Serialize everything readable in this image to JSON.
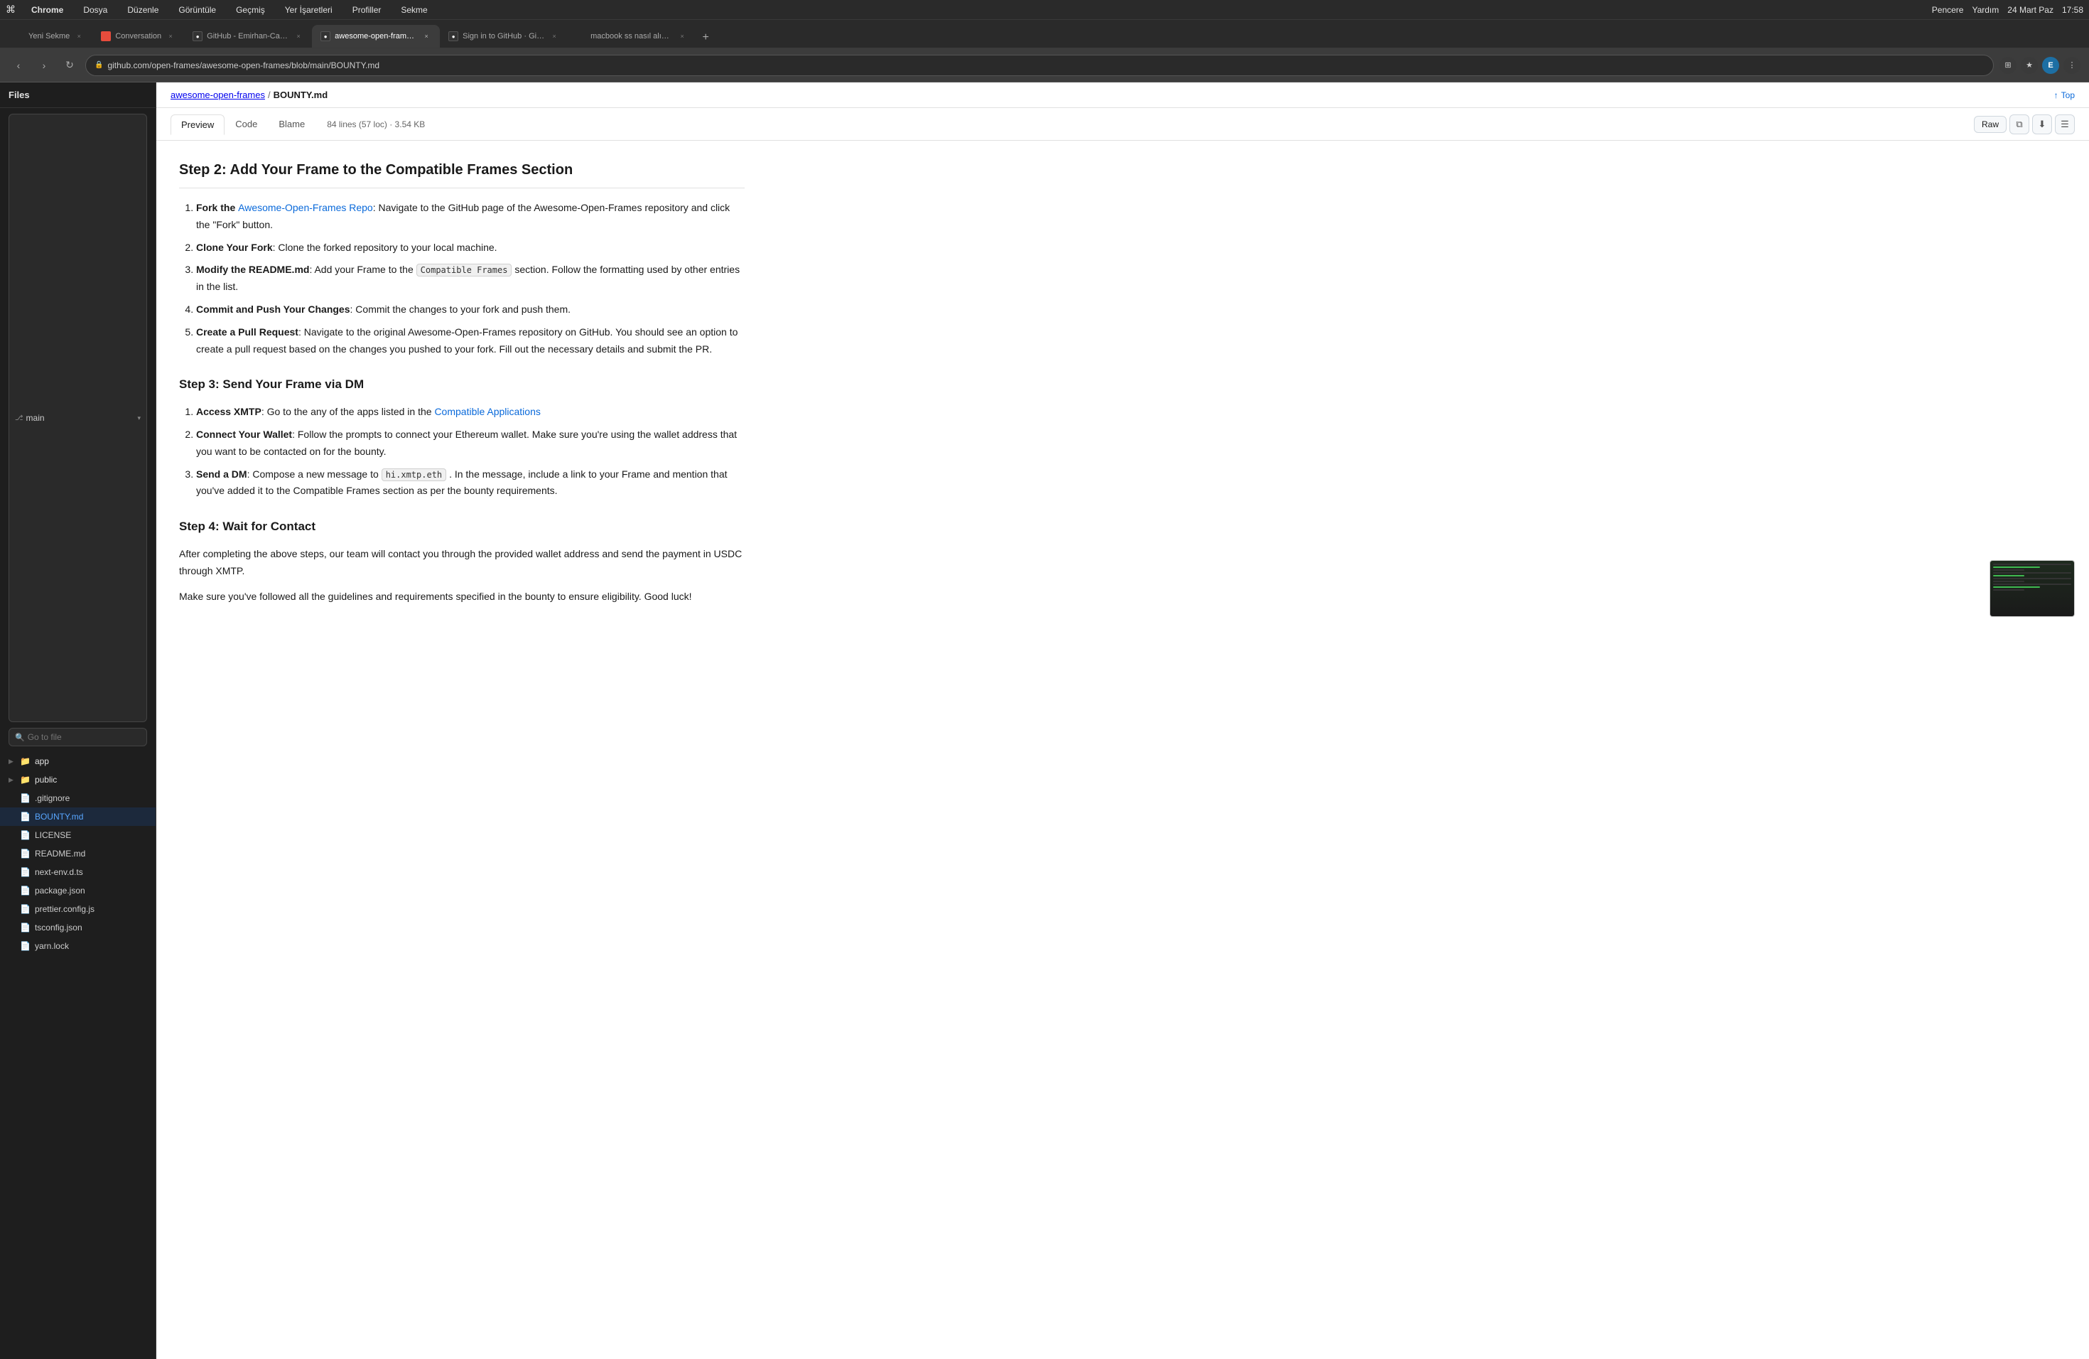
{
  "menubar": {
    "apple": "⌘",
    "chrome_label": "Chrome",
    "items": [
      "Dosya",
      "Düzenle",
      "Görüntüle",
      "Geçmiş",
      "Yer İşaretleri",
      "Profiller",
      "Sekme"
    ],
    "right_items": [
      "Pencere",
      "Yardım"
    ],
    "date": "24 Mart Paz",
    "time": "17:58"
  },
  "tabs": [
    {
      "label": "Yeni Sekme",
      "active": false,
      "favicon_type": "default"
    },
    {
      "label": "Conversation",
      "active": false,
      "favicon_type": "red"
    },
    {
      "label": "GitHub - Emirhan-Cavusc...",
      "active": false,
      "favicon_type": "gh"
    },
    {
      "label": "awesome-open-frames/BC...",
      "active": true,
      "favicon_type": "gh"
    },
    {
      "label": "Sign in to GitHub · GitHub",
      "active": false,
      "favicon_type": "gh"
    },
    {
      "label": "macbook ss nasıl alınır - G...",
      "active": false,
      "favicon_type": "default"
    }
  ],
  "addressbar": {
    "url": "github.com/open-frames/awesome-open-frames/blob/main/BOUNTY.md"
  },
  "sidebar": {
    "title": "Files",
    "branch": "main",
    "search_placeholder": "Go to file",
    "items": [
      {
        "type": "folder",
        "name": "app",
        "indent": false,
        "expanded": false
      },
      {
        "type": "folder",
        "name": "public",
        "indent": false,
        "expanded": false
      },
      {
        "type": "file",
        "name": ".gitignore",
        "indent": false,
        "active": false
      },
      {
        "type": "file",
        "name": "BOUNTY.md",
        "indent": false,
        "active": true
      },
      {
        "type": "file",
        "name": "LICENSE",
        "indent": false,
        "active": false
      },
      {
        "type": "file",
        "name": "README.md",
        "indent": false,
        "active": false
      },
      {
        "type": "file",
        "name": "next-env.d.ts",
        "indent": false,
        "active": false
      },
      {
        "type": "file",
        "name": "package.json",
        "indent": false,
        "active": false
      },
      {
        "type": "file",
        "name": "prettier.config.js",
        "indent": false,
        "active": false
      },
      {
        "type": "file",
        "name": "tsconfig.json",
        "indent": false,
        "active": false
      },
      {
        "type": "file",
        "name": "yarn.lock",
        "indent": false,
        "active": false
      }
    ]
  },
  "file_header": {
    "repo_link": "awesome-open-frames",
    "sep": "/",
    "filename": "BOUNTY.md",
    "top_label": "Top"
  },
  "view_tabs": {
    "tabs": [
      "Preview",
      "Code",
      "Blame"
    ],
    "active": "Preview",
    "meta": "84 lines (57 loc) · 3.54 KB",
    "actions": [
      "Raw"
    ]
  },
  "markdown": {
    "step2_heading": "Step 2: Add Your Frame to the Compatible Frames Section",
    "step2_items": [
      {
        "bold": "Fork the",
        "link_text": "Awesome-Open-Frames Repo",
        "link_href": "#",
        "rest": ": Navigate to the GitHub page of the Awesome-Open-Frames repository and click the \"Fork\" button."
      },
      {
        "bold": "Clone Your Fork",
        "rest": ": Clone the forked repository to your local machine."
      },
      {
        "bold": "Modify the README.md",
        "rest_before_code": ": Add your Frame to the",
        "code": "Compatible Frames",
        "rest_after_code": "section. Follow the formatting used by other entries in the list."
      },
      {
        "bold": "Commit and Push Your Changes",
        "rest": ": Commit the changes to your fork and push them."
      },
      {
        "bold": "Create a Pull Request",
        "rest": ": Navigate to the original Awesome-Open-Frames repository on GitHub. You should see an option to create a pull request based on the changes you pushed to your fork. Fill out the necessary details and submit the PR."
      }
    ],
    "step3_heading": "Step 3: Send Your Frame via DM",
    "step3_items": [
      {
        "bold": "Access XMTP",
        "rest_before_link": ": Go to the any of the apps listed in the",
        "link_text": "Compatible Applications",
        "link_href": "#"
      },
      {
        "bold": "Connect Your Wallet",
        "rest": ": Follow the prompts to connect your Ethereum wallet. Make sure you're using the wallet address that you want to be contacted on for the bounty."
      },
      {
        "bold": "Send a DM",
        "rest_before_code": ": Compose a new message to",
        "code": "hi.xmtp.eth",
        "rest_after_code": ". In the message, include a link to your Frame and mention that you've added it to the Compatible Frames section as per the bounty requirements."
      }
    ],
    "step4_heading": "Step 4: Wait for Contact",
    "step4_p1": "After completing the above steps, our team will contact you through the provided wallet address and send the payment in USDC through XMTP.",
    "step4_p2": "Make sure you've followed all the guidelines and requirements specified in the bounty to ensure eligibility. Good luck!"
  }
}
